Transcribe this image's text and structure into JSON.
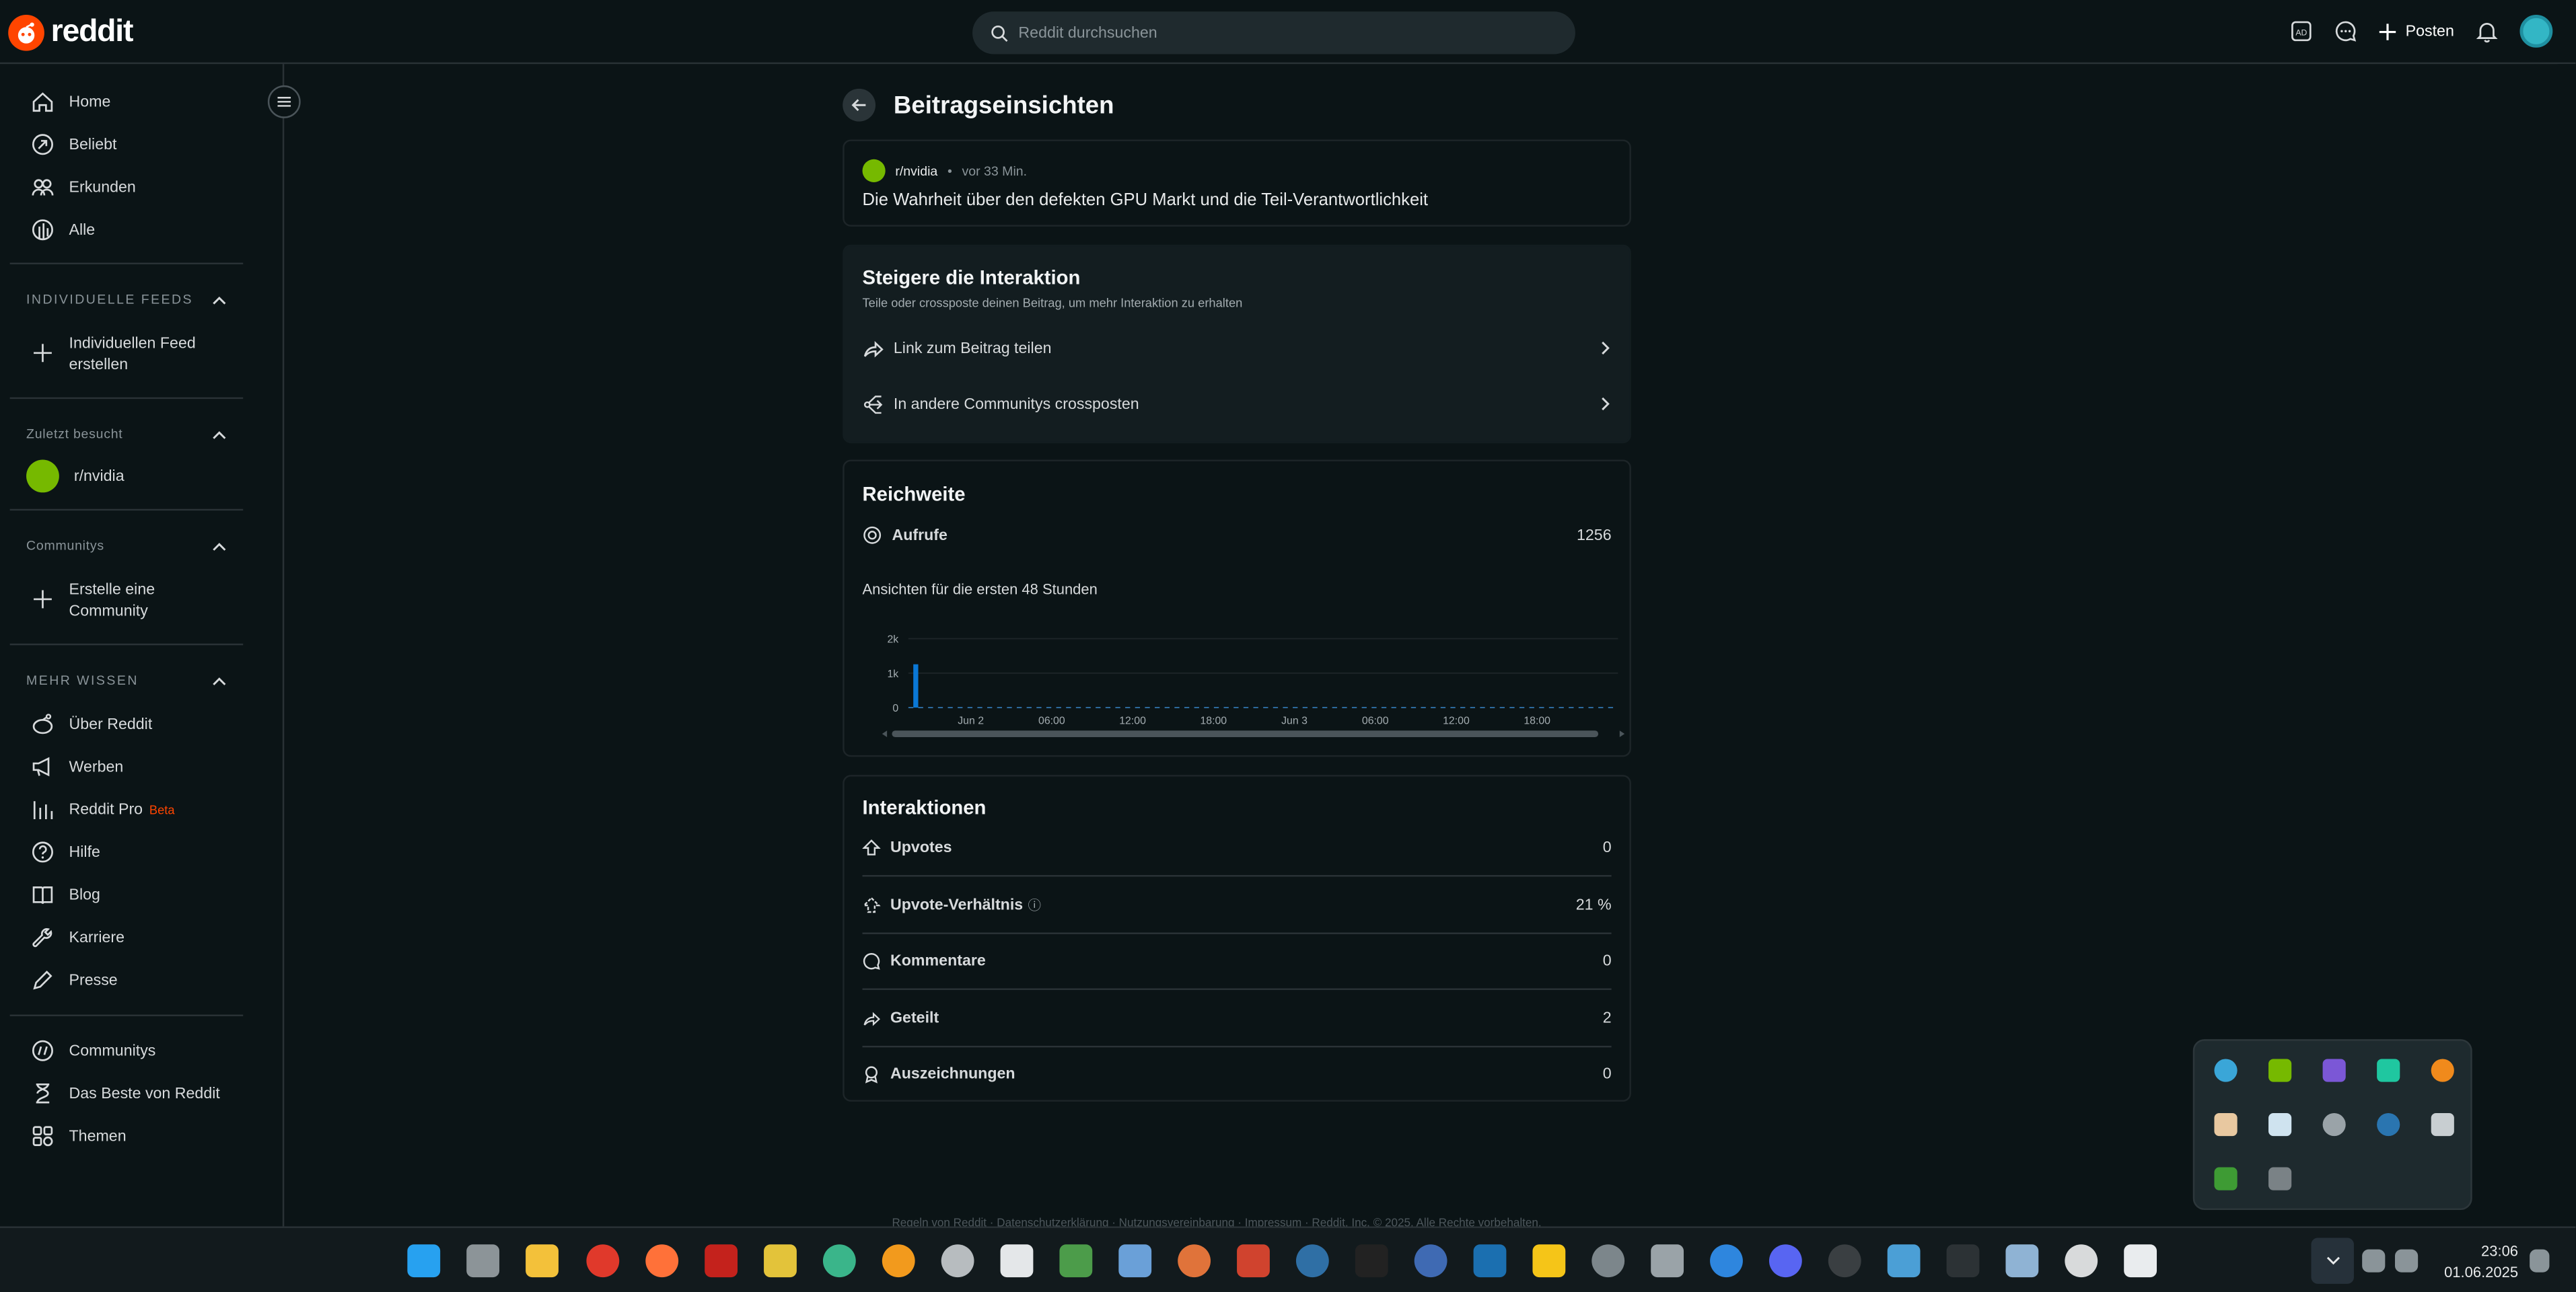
{
  "app": {
    "name": "reddit"
  },
  "search": {
    "placeholder": "Reddit durchsuchen"
  },
  "header": {
    "post_label": "Posten"
  },
  "sidebar": {
    "nav": [
      {
        "label": "Home",
        "icon": "home-icon"
      },
      {
        "label": "Beliebt",
        "icon": "trending-icon"
      },
      {
        "label": "Erkunden",
        "icon": "explore-icon"
      },
      {
        "label": "Alle",
        "icon": "all-icon"
      }
    ],
    "custom_feeds": {
      "heading": "INDIVIDUELLE FEEDS",
      "create_label": "Individuellen Feed erstellen"
    },
    "recent": {
      "heading": "Zuletzt besucht",
      "item": "r/nvidia"
    },
    "communities": {
      "heading": "Communitys",
      "create_label": "Erstelle eine Community"
    },
    "more": {
      "heading": "MEHR WISSEN",
      "items": [
        {
          "label": "Über Reddit",
          "icon": "reddit-alien-icon"
        },
        {
          "label": "Werben",
          "icon": "megaphone-icon"
        },
        {
          "label": "Reddit Pro",
          "icon": "bar-chart-icon",
          "badge": "Beta"
        },
        {
          "label": "Hilfe",
          "icon": "help-icon"
        },
        {
          "label": "Blog",
          "icon": "book-icon"
        },
        {
          "label": "Karriere",
          "icon": "wrench-icon"
        },
        {
          "label": "Presse",
          "icon": "pen-icon"
        }
      ]
    },
    "bottom": [
      {
        "label": "Communitys",
        "icon": "communities-icon"
      },
      {
        "label": "Das Beste von Reddit",
        "icon": "hourglass-icon"
      },
      {
        "label": "Themen",
        "icon": "topics-icon"
      }
    ]
  },
  "page": {
    "title": "Beitragseinsichten"
  },
  "post": {
    "subreddit": "r/nvidia",
    "separator": "•",
    "time": "vor 33 Min.",
    "title": "Die Wahrheit über den defekten GPU Markt und die Teil-Verantwortlichkeit"
  },
  "boost": {
    "title": "Steigere die Interaktion",
    "subtitle": "Teile oder crossposte deinen Beitrag, um mehr Interaktion zu erhalten",
    "share_label": "Link zum Beitrag teilen",
    "crosspost_label": "In andere Communitys crossposten"
  },
  "reach": {
    "title": "Reichweite",
    "views_label": "Aufrufe",
    "views_value": "1256",
    "chart_caption": "Ansichten für die ersten 48 Stunden"
  },
  "chart_data": {
    "type": "bar",
    "y_ticks": [
      "2k",
      "1k",
      "0"
    ],
    "ylim": [
      0,
      2000
    ],
    "x_ticks": [
      "Jun 2",
      "06:00",
      "12:00",
      "18:00",
      "Jun 3",
      "06:00",
      "12:00",
      "18:00"
    ],
    "x": [
      "Jun 1 23:00"
    ],
    "values": [
      1256
    ],
    "bar_color": "#0a78d6"
  },
  "interactions": {
    "title": "Interaktionen",
    "rows": [
      {
        "label": "Upvotes",
        "value": "0",
        "icon": "upvote-icon"
      },
      {
        "label": "Upvote-Verhältnis",
        "value": "21 %",
        "icon": "ratio-icon",
        "info": "ⓘ"
      },
      {
        "label": "Kommentare",
        "value": "0",
        "icon": "comment-icon"
      },
      {
        "label": "Geteilt",
        "value": "2",
        "icon": "share-icon"
      },
      {
        "label": "Auszeichnungen",
        "value": "0",
        "icon": "award-icon"
      }
    ]
  },
  "footer": {
    "text": "Regeln von Reddit · Datenschutzerklärung · Nutzungsvereinbarung · Impressum · Reddit, Inc. © 2025. Alle Rechte vorbehalten."
  },
  "clock": {
    "time": "23:06",
    "date": "01.06.2025"
  },
  "colors": {
    "background": "#0b1416",
    "accent": "#ff4500",
    "card": "#131d20",
    "bar": "#0a78d6"
  }
}
